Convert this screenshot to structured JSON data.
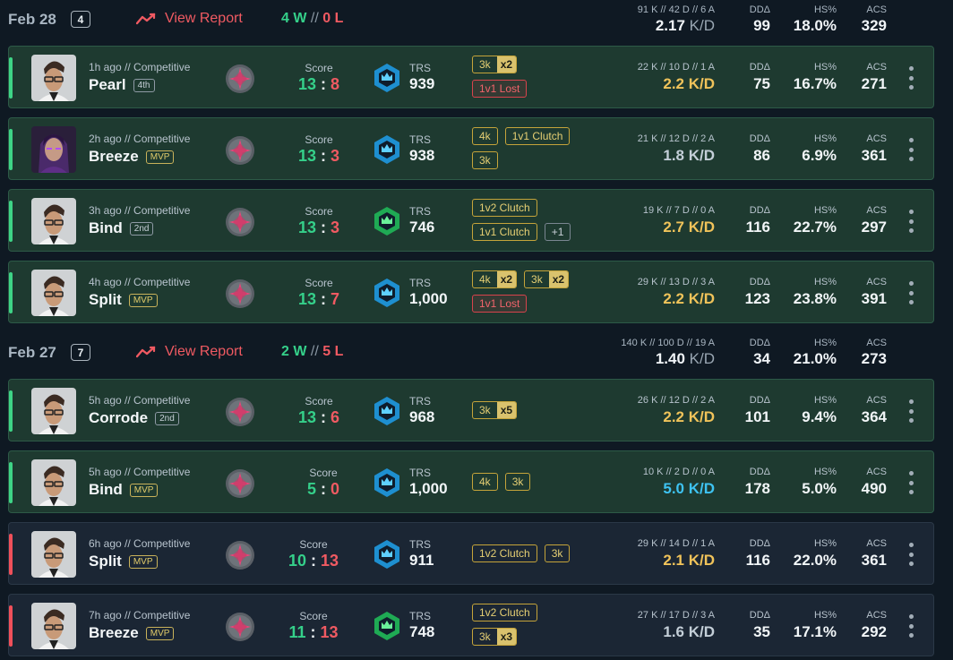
{
  "days": [
    {
      "date": "Feb 28",
      "count": "4",
      "report_label": "View Report",
      "wins": "4 W",
      "sep": "//",
      "losses": "0 L",
      "summary": {
        "kda": "91 K // 42 D // 6 A",
        "kd": "2.17",
        "kd_suffix": "K/D",
        "dd_label": "DDΔ",
        "dd": "99",
        "hs_label": "HS%",
        "hs": "18.0%",
        "acs_label": "ACS",
        "acs": "329"
      }
    },
    {
      "date": "Feb 27",
      "count": "7",
      "report_label": "View Report",
      "wins": "2 W",
      "sep": "//",
      "losses": "5 L",
      "summary": {
        "kda": "140 K // 100 D // 19 A",
        "kd": "1.40",
        "kd_suffix": "K/D",
        "dd_label": "DDΔ",
        "dd": "34",
        "hs_label": "HS%",
        "hs": "21.0%",
        "acs_label": "ACS",
        "acs": "273"
      }
    }
  ],
  "labels": {
    "score": "Score",
    "trs": "TRS",
    "dd": "DDΔ",
    "hs": "HS%",
    "acs": "ACS"
  },
  "matches": [
    {
      "result": "win",
      "meta": "1h ago // Competitive",
      "map": "Pearl",
      "place": "4th",
      "place_type": "normal",
      "score_a": "13",
      "score_b": "8",
      "trs": "939",
      "kda": "22 K // 10 D // 1 A",
      "kd": "2.2 K/D",
      "kd_color": "gold",
      "dd": "75",
      "hs": "16.7%",
      "acs": "271",
      "agent": "chamber",
      "rank_color": "blue"
    },
    {
      "result": "win",
      "meta": "2h ago // Competitive",
      "map": "Breeze",
      "place": "MVP",
      "place_type": "mvp",
      "score_a": "13",
      "score_b": "3",
      "trs": "938",
      "kda": "21 K // 12 D // 2 A",
      "kd": "1.8 K/D",
      "kd_color": "grey",
      "dd": "86",
      "hs": "6.9%",
      "acs": "361",
      "agent": "reyna",
      "rank_color": "blue"
    },
    {
      "result": "win",
      "meta": "3h ago // Competitive",
      "map": "Bind",
      "place": "2nd",
      "place_type": "normal",
      "score_a": "13",
      "score_b": "3",
      "trs": "746",
      "kda": "19 K // 7 D // 0 A",
      "kd": "2.7 K/D",
      "kd_color": "gold",
      "dd": "116",
      "hs": "22.7%",
      "acs": "297",
      "agent": "chamber",
      "rank_color": "green"
    },
    {
      "result": "win",
      "meta": "4h ago // Competitive",
      "map": "Split",
      "place": "MVP",
      "place_type": "mvp",
      "score_a": "13",
      "score_b": "7",
      "trs": "1,000",
      "kda": "29 K // 13 D // 3 A",
      "kd": "2.2 K/D",
      "kd_color": "gold",
      "dd": "123",
      "hs": "23.8%",
      "acs": "391",
      "agent": "chamber",
      "rank_color": "blue"
    },
    {
      "result": "win",
      "meta": "5h ago // Competitive",
      "map": "Corrode",
      "place": "2nd",
      "place_type": "normal",
      "score_a": "13",
      "score_b": "6",
      "trs": "968",
      "kda": "26 K // 12 D // 2 A",
      "kd": "2.2 K/D",
      "kd_color": "gold",
      "dd": "101",
      "hs": "9.4%",
      "acs": "364",
      "agent": "chamber",
      "rank_color": "blue"
    },
    {
      "result": "win",
      "meta": "5h ago // Competitive",
      "map": "Bind",
      "place": "MVP",
      "place_type": "mvp",
      "score_a": "5",
      "score_b": "0",
      "trs": "1,000",
      "kda": "10 K // 2 D // 0 A",
      "kd": "5.0 K/D",
      "kd_color": "blue",
      "dd": "178",
      "hs": "5.0%",
      "acs": "490",
      "agent": "chamber",
      "rank_color": "blue"
    },
    {
      "result": "loss",
      "meta": "6h ago // Competitive",
      "map": "Split",
      "place": "MVP",
      "place_type": "mvp",
      "score_a": "10",
      "score_b": "13",
      "trs": "911",
      "kda": "29 K // 14 D // 1 A",
      "kd": "2.1 K/D",
      "kd_color": "gold",
      "dd": "116",
      "hs": "22.0%",
      "acs": "361",
      "agent": "chamber",
      "rank_color": "blue"
    },
    {
      "result": "loss",
      "meta": "7h ago // Competitive",
      "map": "Breeze",
      "place": "MVP",
      "place_type": "mvp",
      "score_a": "11",
      "score_b": "13",
      "trs": "748",
      "kda": "27 K // 17 D // 3 A",
      "kd": "1.6 K/D",
      "kd_color": "grey",
      "dd": "35",
      "hs": "17.1%",
      "acs": "292",
      "agent": "chamber",
      "rank_color": "green"
    }
  ],
  "tags": {
    "m0": {
      "r1a_label": "3k",
      "r1a_mult": "x2",
      "r2a_label": "1v1 Lost"
    },
    "m1": {
      "r1a_label": "4k",
      "r1b_label": "1v1 Clutch",
      "r2a_label": "3k"
    },
    "m2": {
      "r1a_label": "1v2 Clutch",
      "r2a_label": "1v1 Clutch",
      "r2b_label": "+1"
    },
    "m3": {
      "r1a_label": "4k",
      "r1a_mult": "x2",
      "r1b_label": "3k",
      "r1b_mult": "x2",
      "r2a_label": "1v1 Lost"
    },
    "m4": {
      "r1a_label": "3k",
      "r1a_mult": "x5"
    },
    "m5": {
      "r1a_label": "4k",
      "r1b_label": "3k"
    },
    "m6": {
      "r1a_label": "1v2 Clutch",
      "r1b_label": "3k"
    },
    "m7": {
      "r1a_label": "1v2 Clutch",
      "r2a_label": "3k",
      "r2a_mult": "x3"
    }
  },
  "colors": {
    "win": "#35d08a",
    "loss": "#f05a62",
    "gold": "#f0c35a",
    "blue": "#3ec3f2"
  },
  "icons": {
    "report": "trend-line-icon",
    "agent_role": "agent-role-icon",
    "rank": "rank-icon",
    "more": "more-vertical-icon"
  }
}
